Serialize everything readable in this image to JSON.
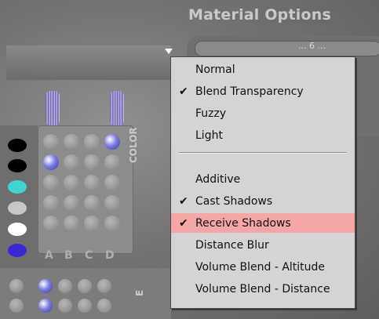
{
  "header": {
    "title": "Material Options"
  },
  "control_panel": {
    "text": "... 6 ..."
  },
  "grid": {
    "label": "COLOR",
    "columns": [
      "A",
      "B",
      "C",
      "D"
    ],
    "bottom_label": "E",
    "swatch_colors": [
      "#000000",
      "#000000",
      "#3fd4d0",
      "#c7c7c7",
      "#ffffff",
      "#3a27d3"
    ]
  },
  "menu": {
    "items": [
      {
        "label": "Normal",
        "checked": ""
      },
      {
        "label": "Blend Transparency",
        "checked": "✔"
      },
      {
        "label": "Fuzzy",
        "checked": ""
      },
      {
        "label": "Light",
        "checked": ""
      },
      {
        "label": "Additive",
        "checked": ""
      },
      {
        "label": "Cast Shadows",
        "checked": "✔"
      },
      {
        "label": "Receive Shadows",
        "checked": "✔",
        "highlighted": true
      },
      {
        "label": "Distance Blur",
        "checked": ""
      },
      {
        "label": "Volume Blend - Altitude",
        "checked": ""
      },
      {
        "label": "Volume Blend - Distance",
        "checked": ""
      }
    ]
  },
  "colors": {
    "highlight": "#f5a6a7",
    "menu_bg": "#d4d4d4"
  }
}
